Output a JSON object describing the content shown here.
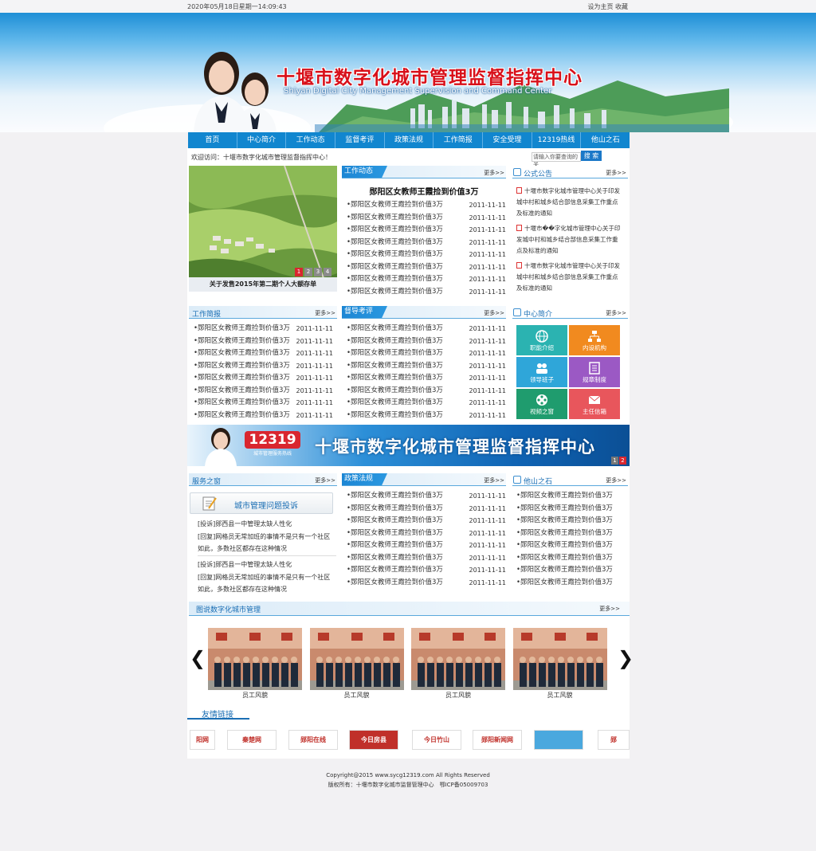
{
  "topbar": {
    "datetime": "2020年05月18日星期一14:09:43",
    "links": "设为主页 收藏"
  },
  "header": {
    "title_cn": "十堰市数字化城市管理监督指挥中心",
    "title_en": "Shiyan Digital City Management Supervision and Command Center"
  },
  "nav": [
    "首页",
    "中心简介",
    "工作动态",
    "监督考评",
    "政策法规",
    "工作简报",
    "安全受理",
    "12319热线",
    "他山之石"
  ],
  "welcome": "欢迎访问：十堰市数字化城市管理监督指挥中心！",
  "search": {
    "placeholder": "请输入你要查询的关",
    "button": "搜 索"
  },
  "more": "更多>>",
  "slider": {
    "caption": "关于发售2015年第二期个人大额存单",
    "pages": [
      "1",
      "2",
      "3",
      "4"
    ]
  },
  "work_news": {
    "title": "工作动态",
    "headline": "郧阳区女教师王霞捡到价值3万",
    "items": [
      {
        "t": "•郧阳区女教师王霞捡到价值3万",
        "d": "2011-11-11"
      },
      {
        "t": "•郧阳区女教师王霞捡到价值3万",
        "d": "2011-11-11"
      },
      {
        "t": "•郧阳区女教师王霞捡到价值3万",
        "d": "2011-11-11"
      },
      {
        "t": "•郧阳区女教师王霞捡到价值3万",
        "d": "2011-11-11"
      },
      {
        "t": "•郧阳区女教师王霞捡到价值3万",
        "d": "2011-11-11"
      },
      {
        "t": "•郧阳区女教师王霞捡到价值3万",
        "d": "2011-11-11"
      },
      {
        "t": "•郧阳区女教师王霞捡到价值3万",
        "d": "2011-11-11"
      },
      {
        "t": "•郧阳区女教师王霞捡到价值3万",
        "d": "2011-11-11"
      }
    ]
  },
  "announcements": {
    "title": "公式公告",
    "items": [
      "十堰市数字化城市管理中心关于印发城中村和城乡结合部信息采集工作重点及标准的通知",
      "十堰市��字化城市管理中心关于印发城中村和城乡结合部信息采集工作重点及标准的通知",
      "十堰市数字化城市管理中心关于印发城中村和城乡结合部信息采集工作重点及标准的通知"
    ]
  },
  "briefing": {
    "title": "工作简报",
    "items": [
      {
        "t": "•郧阳区女教师王霞捡到价值3万",
        "d": "2011-11-11"
      },
      {
        "t": "•郧阳区女教师王霞捡到价值3万",
        "d": "2011-11-11"
      },
      {
        "t": "•郧阳区女教师王霞捡到价值3万",
        "d": "2011-11-11"
      },
      {
        "t": "•郧阳区女教师王霞捡到价值3万",
        "d": "2011-11-11"
      },
      {
        "t": "•郧阳区女教师王霞捡到价值3万",
        "d": "2011-11-11"
      },
      {
        "t": "•郧阳区女教师王霞捡到价值3万",
        "d": "2011-11-11"
      },
      {
        "t": "•郧阳区女教师王霞捡到价值3万",
        "d": "2011-11-11"
      },
      {
        "t": "•郧阳区女教师王霞捡到价值3万",
        "d": "2011-11-11"
      }
    ]
  },
  "supervision": {
    "title": "督导考评",
    "items": [
      {
        "t": "•郧阳区女教师王霞捡到价值3万",
        "d": "2011-11-11"
      },
      {
        "t": "•郧阳区女教师王霞捡到价值3万",
        "d": "2011-11-11"
      },
      {
        "t": "•郧阳区女教师王霞捡到价值3万",
        "d": "2011-11-11"
      },
      {
        "t": "•郧阳区女教师王霞捡到价值3万",
        "d": "2011-11-11"
      },
      {
        "t": "•郧阳区女教师王霞捡到价值3万",
        "d": "2011-11-11"
      },
      {
        "t": "•郧阳区女教师王霞捡到价值3万",
        "d": "2011-11-11"
      },
      {
        "t": "•郧阳区女教师王霞捡到价值3万",
        "d": "2011-11-11"
      },
      {
        "t": "•郧阳区女教师王霞捡到价值3万",
        "d": "2011-11-11"
      }
    ]
  },
  "center_intro": {
    "title": "中心简介",
    "tiles": [
      {
        "label": "职能介绍",
        "color": "#2bb3b1",
        "icon": "globe-icon"
      },
      {
        "label": "内设机构",
        "color": "#f18a1f",
        "icon": "org-chart-icon"
      },
      {
        "label": "领导班子",
        "color": "#2fa6d9",
        "icon": "people-icon"
      },
      {
        "label": "规章制度",
        "color": "#9b59c4",
        "icon": "document-icon"
      },
      {
        "label": "视频之窗",
        "color": "#1f9c6e",
        "icon": "film-reel-icon"
      },
      {
        "label": "主任信箱",
        "color": "#e8565c",
        "icon": "mail-icon"
      }
    ]
  },
  "mid_banner": {
    "hotline": "12319",
    "hotline_sub": "城市管理服务热线",
    "title": "十堰市数字化城市管理监督指挥中心",
    "pages": [
      "1",
      "2"
    ]
  },
  "service": {
    "title": "服务之窗",
    "button": "城市管理问题投诉",
    "entries": [
      {
        "q": "[投诉]郧西县一中管理太缺人性化",
        "a": "[回复]网格员无常加班的事情不是只有一个社区如此，多数社区都存在这种情况"
      },
      {
        "q": "[投诉]郧西县一中管理太缺人性化",
        "a": "[回复]网格员无常加班的事情不是只有一个社区如此，多数社区都存在这种情况"
      }
    ]
  },
  "policy": {
    "title": "政策法规",
    "items": [
      {
        "t": "•郧阳区女教师王霞捡到价值3万",
        "d": "2011-11-11"
      },
      {
        "t": "•郧阳区女教师王霞捡到价值3万",
        "d": "2011-11-11"
      },
      {
        "t": "•郧阳区女教师王霞捡到价值3万",
        "d": "2011-11-11"
      },
      {
        "t": "•郧阳区女教师王霞捡到价值3万",
        "d": "2011-11-11"
      },
      {
        "t": "•郧阳区女教师王霞捡到价值3万",
        "d": "2011-11-11"
      },
      {
        "t": "•郧阳区女教师王霞捡到价值3万",
        "d": "2011-11-11"
      },
      {
        "t": "•郧阳区女教师王霞捡到价值3万",
        "d": "2011-11-11"
      },
      {
        "t": "•郧阳区女教师王霞捡到价值3万",
        "d": "2011-11-11"
      }
    ]
  },
  "other_stones": {
    "title": "他山之石",
    "items": [
      "•郧阳区女教师王霞捡到价值3万",
      "•郧阳区女教师王霞捡到价值3万",
      "•郧阳区女教师王霞捡到价值3万",
      "•郧阳区女教师王霞捡到价值3万",
      "•郧阳区女教师王霞捡到价值3万",
      "•郧阳区女教师王霞捡到价值3万",
      "•郧阳区女教师王霞捡到价值3万",
      "•郧阳区女教师王霞捡到价值3万"
    ]
  },
  "gallery": {
    "title": "图说数字化城市管理",
    "captions": [
      "员工风貌",
      "员工风貌",
      "员工风貌",
      "员工风貌"
    ],
    "left_arrow": "❮",
    "right_arrow": "❯"
  },
  "friend_links": {
    "title": "友情链接",
    "items": [
      {
        "text": "阳网",
        "color": "#c0302a"
      },
      {
        "text": "秦楚网",
        "color": "#c0302a"
      },
      {
        "text": "郧阳在线",
        "color": "#c0302a"
      },
      {
        "text": "今日房县",
        "color": "#ffffff"
      },
      {
        "text": "今日竹山",
        "color": "#c0302a"
      },
      {
        "text": "郧阳新闻网",
        "color": "#c0302a"
      },
      {
        "text": "",
        "color": "#1a7fc8"
      },
      {
        "text": "郧",
        "color": "#c0302a"
      }
    ]
  },
  "footer": {
    "copyright": "Copyright@2015 www.sycg12319.com All Rights Reserved",
    "owner": "版权所有：十堰市数字化城市监督管理中心　鄂ICP备05009703"
  }
}
